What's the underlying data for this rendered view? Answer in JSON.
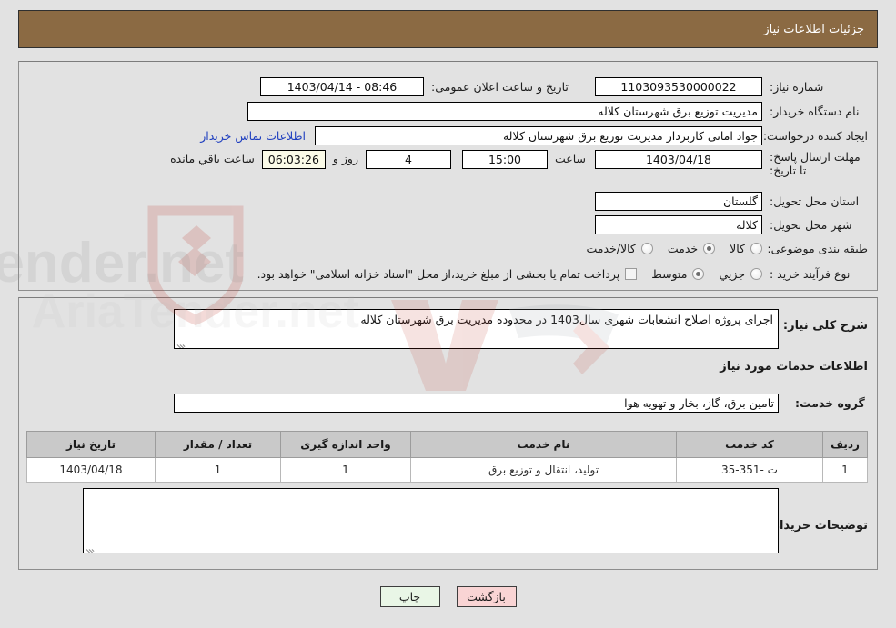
{
  "header": {
    "title": "جزئیات اطلاعات نیاز",
    "bg_color": "#8b6a43",
    "text_color": "#ffffff"
  },
  "top_panel": {
    "need_number": {
      "label": "شماره نیاز:",
      "value": "1103093530000022"
    },
    "announce_datetime": {
      "label": "تاریخ و ساعت اعلان عمومی:",
      "value": "08:46 - 1403/04/14"
    },
    "buyer_org": {
      "label": "نام دستگاه خریدار:",
      "value": "مدیریت توزیع برق شهرستان کلاله"
    },
    "request_creator": {
      "label": "ایجاد کننده درخواست:",
      "value": "جواد امانی کاربرداز مدیریت توزیع برق شهرستان کلاله"
    },
    "buyer_contact_link": "اطلاعات تماس خریدار",
    "deadline": {
      "label": "مهلت ارسال پاسخ: تا تاریخ:",
      "date": "1403/04/18",
      "time_label": "ساعت",
      "time": "15:00",
      "days": "4",
      "days_unit": "روز و",
      "countdown": "06:03:26",
      "countdown_unit": "ساعت باقي مانده"
    },
    "delivery_province": {
      "label": "استان محل تحویل:",
      "value": "گلستان"
    },
    "delivery_city": {
      "label": "شهر محل تحویل:",
      "value": "کلاله"
    },
    "category": {
      "label": "طبقه بندی موضوعی:",
      "options": [
        "کالا",
        "خدمت",
        "کالا/خدمت"
      ],
      "selected": "خدمت"
    },
    "purchase_process": {
      "label": "نوع فرآیند خرید :",
      "options": [
        "جزیي",
        "متوسط",
        "پرداخت تمام یا بخشی از مبلغ خرید،از محل \"اسناد خزانه اسلامی\" خواهد بود."
      ],
      "selected": "متوسط",
      "checkbox_label": "پرداخت تمام یا بخشی از مبلغ خرید،از محل \"اسناد خزانه اسلامی\" خواهد بود.",
      "checkbox_checked": false
    }
  },
  "bottom_panel": {
    "general_description": {
      "label": "شرح کلی نیاز:",
      "value": "اجرای پروژه اصلاح انشعابات شهری سال1403 در محدوده مدیریت برق شهرستان کلاله"
    },
    "services_section_title": "اطلاعات خدمات مورد نیاز",
    "service_group": {
      "label": "گروه خدمت:",
      "value": "تامین برق، گاز، بخار و تهویه هوا"
    },
    "table": {
      "columns": [
        "ردیف",
        "کد خدمت",
        "نام خدمت",
        "واحد اندازه گیری",
        "تعداد / مقدار",
        "تاریخ نیاز"
      ],
      "rows": [
        [
          "1",
          "ت -351-35",
          "تولید، انتقال و توزیع برق",
          "1",
          "1",
          "1403/04/18"
        ]
      ]
    },
    "buyer_notes": {
      "label": "توضیحات خریدار:",
      "value": ""
    }
  },
  "buttons": {
    "back": "بازگشت",
    "print": "چاپ"
  },
  "watermark": {
    "text": "AriaTender.net"
  }
}
